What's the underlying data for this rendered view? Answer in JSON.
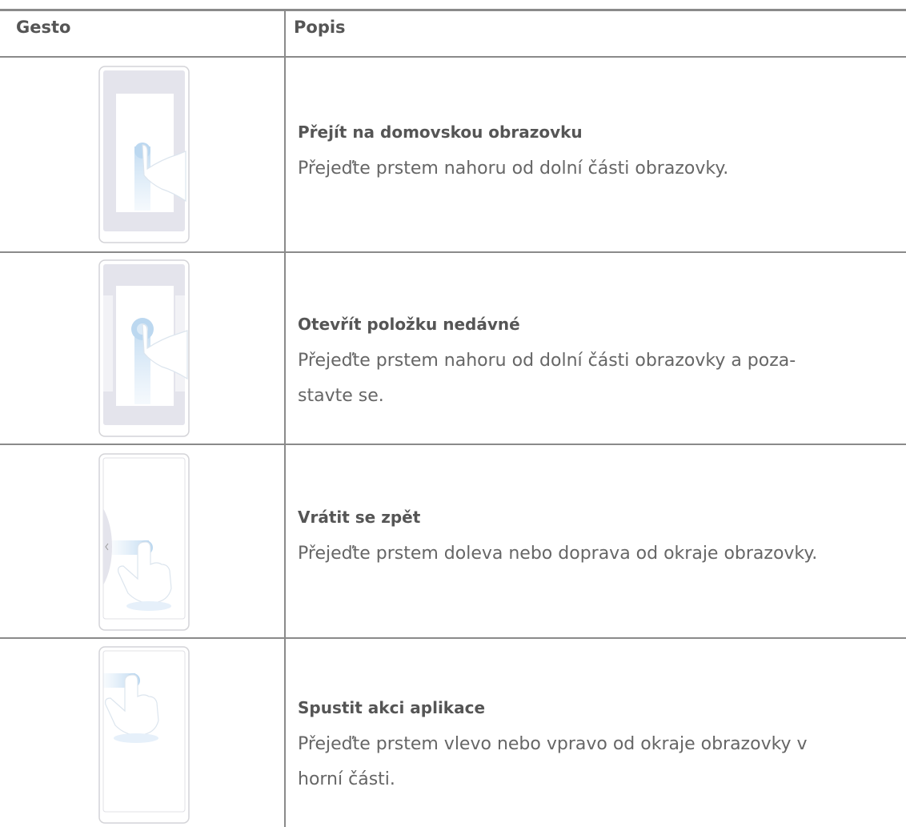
{
  "table": {
    "headers": {
      "gesture": "Gesto",
      "description": "Popis"
    },
    "rows": [
      {
        "title": "Přejít na domovskou obrazovku",
        "lines": [
          "Přejeďte prstem nahoru od dolní části obrazovky."
        ],
        "illustration": "swipe-up-home-icon"
      },
      {
        "title": "Otevřít položku nedávné",
        "lines": [
          "Přejeďte prstem nahoru od dolní části obrazovky a poza-",
          "stavte se."
        ],
        "illustration": "swipe-up-hold-recents-icon"
      },
      {
        "title": "Vrátit se zpět",
        "lines": [
          "Přejeďte prstem doleva nebo doprava od okraje obrazovky."
        ],
        "illustration": "swipe-edge-back-icon"
      },
      {
        "title": "Spustit akci aplikace",
        "lines": [
          "Přejeďte prstem vlevo nebo vpravo od okraje obrazovky v",
          "horní části."
        ],
        "illustration": "swipe-edge-top-action-icon"
      }
    ]
  },
  "colors": {
    "rule": "#8a8a8a",
    "screen": "#e4e4ec",
    "swipe": "#cfe3f5"
  }
}
